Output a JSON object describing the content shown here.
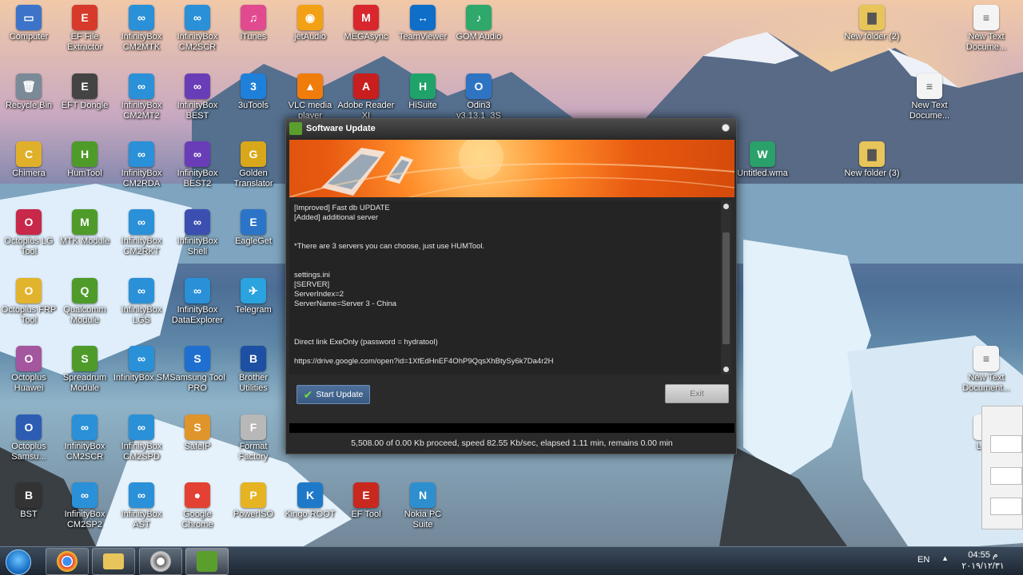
{
  "desktop_icons": [
    {
      "label": "Computer",
      "color": "#3d74c9",
      "glyph": "▭"
    },
    {
      "label": "EF File Extractor",
      "color": "#d73a2b",
      "glyph": "E"
    },
    {
      "label": "InfinityBox CM2MTK",
      "color": "#2a90d8",
      "glyph": "∞"
    },
    {
      "label": "InfinityBox CM2SCR",
      "color": "#2a90d8",
      "glyph": "∞"
    },
    {
      "label": "iTunes",
      "color": "#e24a8f",
      "glyph": "♫"
    },
    {
      "label": "jetAudio",
      "color": "#f3a114",
      "glyph": "◉"
    },
    {
      "label": "MEGAsync",
      "color": "#d9272e",
      "glyph": "M"
    },
    {
      "label": "TeamViewer",
      "color": "#0e6ec8",
      "glyph": "↔"
    },
    {
      "label": "GOM Audio",
      "color": "#2ea86b",
      "glyph": "♪"
    },
    {
      "label": "Recycle Bin",
      "color": "#7a8a99",
      "glyph": "🗑"
    },
    {
      "label": "EFT Dongle",
      "color": "#444444",
      "glyph": "E"
    },
    {
      "label": "InfinityBox CM2MT2",
      "color": "#2a90d8",
      "glyph": "∞"
    },
    {
      "label": "InfinityBox BEST",
      "color": "#6a3db8",
      "glyph": "∞"
    },
    {
      "label": "3uTools",
      "color": "#1f80d9",
      "glyph": "3"
    },
    {
      "label": "VLC media player",
      "color": "#f07c0c",
      "glyph": "▲"
    },
    {
      "label": "Adobe Reader XI",
      "color": "#c81e1e",
      "glyph": "A"
    },
    {
      "label": "HiSuite",
      "color": "#1fa36a",
      "glyph": "H"
    },
    {
      "label": "Odin3 v3.13.1_3S",
      "color": "#2f73c3",
      "glyph": "O"
    },
    {
      "label": "Chimera",
      "color": "#e0b02a",
      "glyph": "C"
    },
    {
      "label": "HumTool",
      "color": "#4e9b2a",
      "glyph": "H"
    },
    {
      "label": "InfinityBox CM2RDA",
      "color": "#2a90d8",
      "glyph": "∞"
    },
    {
      "label": "InfinityBox BEST2",
      "color": "#6a3db8",
      "glyph": "∞"
    },
    {
      "label": "Golden Translator",
      "color": "#d9a81a",
      "glyph": "G"
    },
    {
      "label": "Octoplus LG Tool",
      "color": "#c8284a",
      "glyph": "O"
    },
    {
      "label": "MTK Module",
      "color": "#4e9b2a",
      "glyph": "M"
    },
    {
      "label": "InfinityBox CM2RKT",
      "color": "#2a90d8",
      "glyph": "∞"
    },
    {
      "label": "InfinityBox Shell",
      "color": "#3c4fb0",
      "glyph": "∞"
    },
    {
      "label": "EagleGet",
      "color": "#2b74c8",
      "glyph": "E"
    },
    {
      "label": "Octoplus FRP Tool",
      "color": "#e2b32c",
      "glyph": "O"
    },
    {
      "label": "Qualcomm Module",
      "color": "#4e9b2a",
      "glyph": "Q"
    },
    {
      "label": "InfinityBox LGS",
      "color": "#2a90d8",
      "glyph": "∞"
    },
    {
      "label": "InfinityBox DataExplorer",
      "color": "#2a90d8",
      "glyph": "∞"
    },
    {
      "label": "Telegram",
      "color": "#2aa3df",
      "glyph": "✈"
    },
    {
      "label": "Octoplus Huawei",
      "color": "#a4569e",
      "glyph": "O"
    },
    {
      "label": "Spreadrum Module",
      "color": "#4e9b2a",
      "glyph": "S"
    },
    {
      "label": "InfinityBox SM",
      "color": "#2a90d8",
      "glyph": "∞"
    },
    {
      "label": "Samsung Tool PRO",
      "color": "#1f6fd1",
      "glyph": "S"
    },
    {
      "label": "Brother Utilities",
      "color": "#1d4fa3",
      "glyph": "B"
    },
    {
      "label": "Octoplus Samsu...",
      "color": "#2d5db3",
      "glyph": "O"
    },
    {
      "label": "InfinityBox CM2SCR",
      "color": "#2a90d8",
      "glyph": "∞"
    },
    {
      "label": "InfinityBox CM2SPD",
      "color": "#2a90d8",
      "glyph": "∞"
    },
    {
      "label": "SafeIP",
      "color": "#e0952a",
      "glyph": "S"
    },
    {
      "label": "Format Factory",
      "color": "#b8b8b8",
      "glyph": "F"
    },
    {
      "label": "BST",
      "color": "#333333",
      "glyph": "B"
    },
    {
      "label": "InfinityBox CM2SP2",
      "color": "#2a90d8",
      "glyph": "∞"
    },
    {
      "label": "InfinityBox AST",
      "color": "#2a90d8",
      "glyph": "∞"
    },
    {
      "label": "Google Chrome",
      "color": "#e34133",
      "glyph": "●"
    },
    {
      "label": "PowerISO",
      "color": "#e6b422",
      "glyph": "P"
    },
    {
      "label": "Kingo ROOT",
      "color": "#1e7ac8",
      "glyph": "K"
    },
    {
      "label": "EF Tool",
      "color": "#c8281e",
      "glyph": "E"
    },
    {
      "label": "Nokia PC Suite",
      "color": "#2e8fcf",
      "glyph": "N"
    },
    {
      "label": "New folder (2)",
      "color": "#e8c55a",
      "glyph": "▇"
    },
    {
      "label": "New Text Docume...",
      "color": "#f4f4f4",
      "glyph": "≡"
    },
    {
      "label": "New Text Docume...",
      "color": "#f4f4f4",
      "glyph": "≡"
    },
    {
      "label": "Untitled.wma",
      "color": "#2aa06a",
      "glyph": "W"
    },
    {
      "label": "New folder (3)",
      "color": "#e8c55a",
      "glyph": "▇"
    },
    {
      "label": "New Text Document...",
      "color": "#f4f4f4",
      "glyph": "≡"
    },
    {
      "label": "Lang",
      "color": "#f4f4f4",
      "glyph": "≡"
    }
  ],
  "dialog": {
    "title": "Software Update",
    "notes": [
      "[Improved] Fast db UPDATE",
      "[Added] additional server",
      "",
      "",
      "*There are 3 servers you can choose, just use HUMTool.",
      "",
      "",
      "settings.ini",
      "[SERVER]",
      "ServerIndex=2",
      "ServerName=Server 3 - China",
      "",
      "",
      "",
      "Direct link ExeOnly (password = hydratool)",
      "",
      "https://drive.google.com/open?id=1XfEdHnEF4OhP9QqsXhBtySy6k7Da4r2H"
    ],
    "start_button": "Start Update",
    "exit_button": "Exit",
    "status": "5,508.00 of 0.00 Kb proceed, speed 82.55 Kb/sec, elapsed 1.11 min, remains 0.00 min"
  },
  "taskbar": {
    "language": "EN",
    "time": "04:55 م",
    "date": "٢٠١٩/١٢/٣١"
  }
}
